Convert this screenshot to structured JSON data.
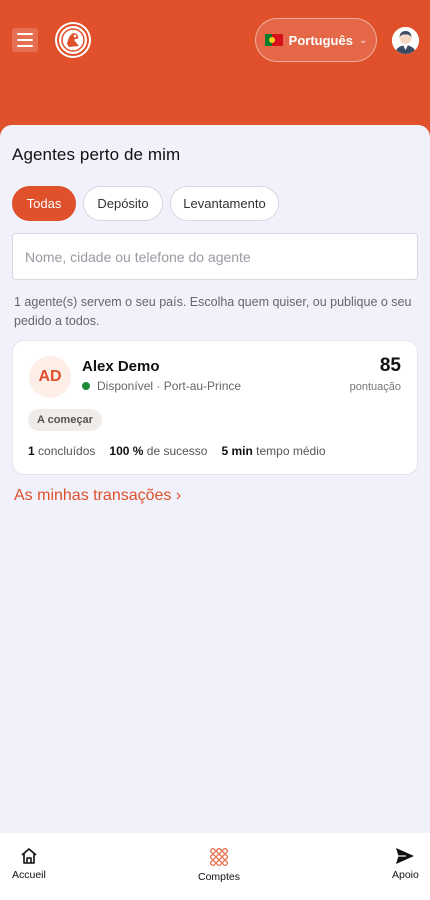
{
  "header": {
    "language": {
      "label": "Português",
      "flag": "portugal-flag-icon"
    },
    "brand_color": "#e0502a"
  },
  "main": {
    "title": "Agentes perto de mim",
    "filters": [
      {
        "label": "Todas",
        "active": true
      },
      {
        "label": "Depósito",
        "active": false
      },
      {
        "label": "Levantamento",
        "active": false
      }
    ],
    "search": {
      "placeholder": "Nome, cidade ou telefone do agente",
      "value": ""
    },
    "info_text": "1 agente(s) servem o seu país. Escolha quem quiser, ou publique o seu pedido a todos.",
    "agents": [
      {
        "initials": "AD",
        "name": "Alex Demo",
        "status": "Disponível · Port-au-Prince",
        "status_color": "#1f8a3a",
        "score": "85",
        "score_label": "pontuação",
        "badge": "A começar",
        "completed_value": "1",
        "completed_label": "concluídos",
        "success_value": "100 %",
        "success_label": "de sucesso",
        "time_value": "5 min",
        "time_label": "tempo médio"
      }
    ],
    "transactions_link": "As minhas transações ›"
  },
  "bottom_nav": [
    {
      "label": "Accueil",
      "icon": "home-icon"
    },
    {
      "label": "Comptes",
      "icon": "grid-icon"
    },
    {
      "label": "Apoio",
      "icon": "send-icon"
    }
  ]
}
